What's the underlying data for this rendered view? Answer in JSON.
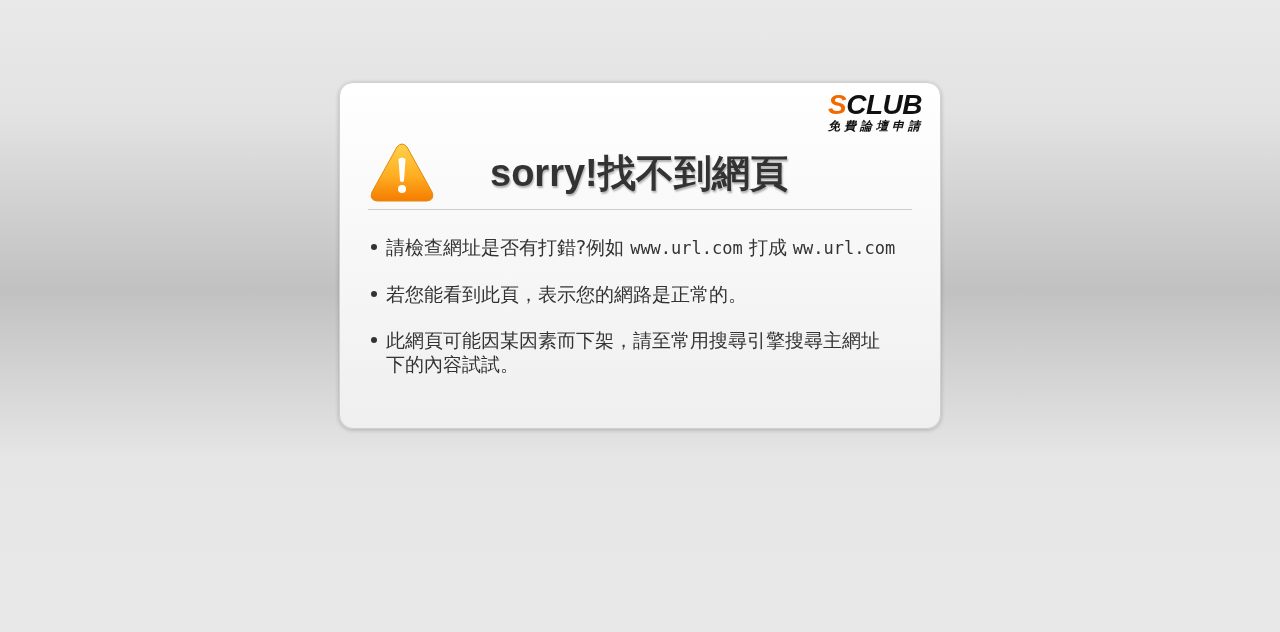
{
  "logo": {
    "accent": "S",
    "text": "CLUB",
    "tagline": "免費論壇申請"
  },
  "title": "sorry!找不到網頁",
  "items": [
    {
      "parts": [
        {
          "kind": "text",
          "text": "請檢查網址是否有打錯?例如"
        },
        {
          "kind": "code",
          "text": "www.url.com"
        },
        {
          "kind": "text",
          "text": "打成"
        },
        {
          "kind": "code",
          "text": "ww.url.com"
        }
      ]
    },
    {
      "parts": [
        {
          "kind": "text",
          "text": "若您能看到此頁，表示您的網路是正常的。"
        }
      ]
    },
    {
      "parts": [
        {
          "kind": "text",
          "text": "此網頁可能因某因素而下架，請至常用搜尋引擎搜尋主網址下的內容試試。"
        }
      ]
    }
  ]
}
